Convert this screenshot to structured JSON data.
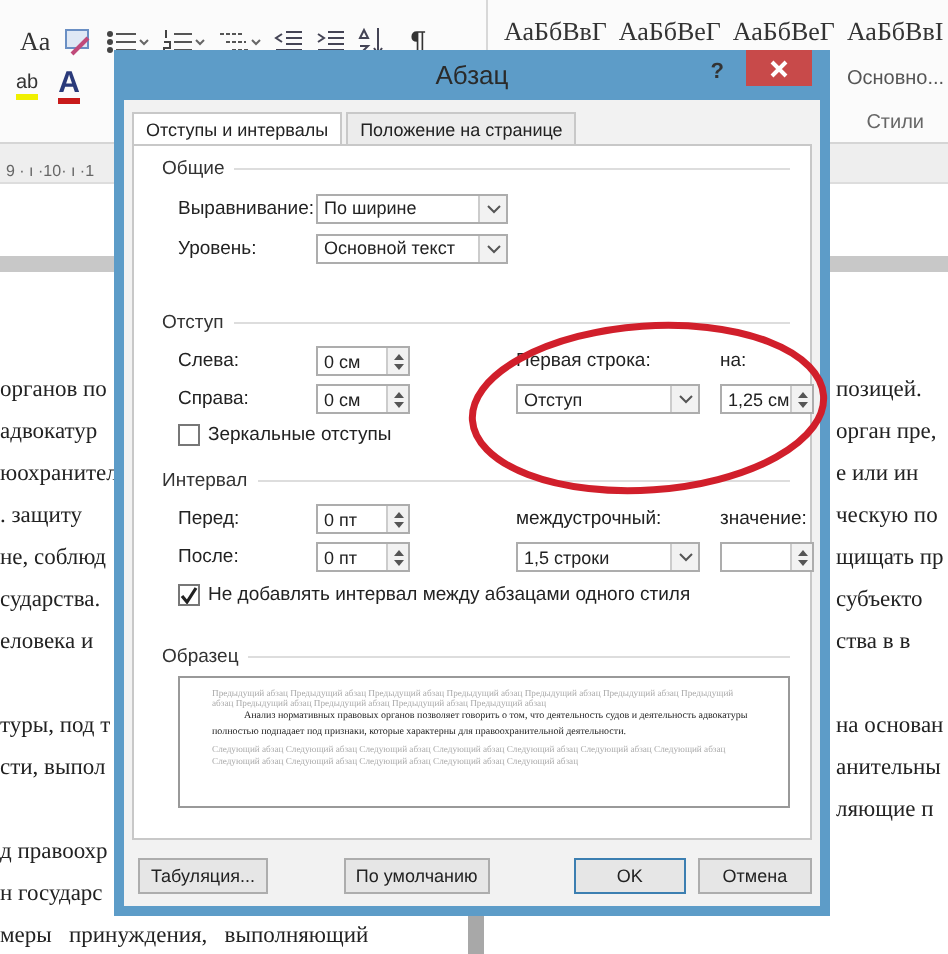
{
  "ribbon": {
    "change_case": "Aa",
    "highlight": "ab",
    "font_color": "A",
    "show_marks": "¶",
    "styles": [
      {
        "sample": "АаБбВвГ"
      },
      {
        "sample": "АаБбВеГ"
      },
      {
        "sample": "АаБбВеГ"
      },
      {
        "sample": "АаБбВвI",
        "name": "Основно..."
      }
    ],
    "styles_group": "Стили",
    "ruler": "9 · ı ·10· ı ·1"
  },
  "document": {
    "rows": [
      {
        "left": "органов по",
        "right": "позицей."
      },
      {
        "left": "адвокатур",
        "right": "орган пре,"
      },
      {
        "left": "юохранител",
        "right": "е или ин"
      },
      {
        "left": ". защиту",
        "right": "ческую по"
      },
      {
        "left": "не, соблюд",
        "right": "щищать пр"
      },
      {
        "left": "сударства.",
        "right": "субъекто"
      },
      {
        "left": "еловека и",
        "right": "ства в в"
      },
      {},
      {
        "left": "туры, под т",
        "right": "на основан"
      },
      {
        "left": "сти, выпол",
        "right": "анительны"
      },
      {
        "right": "ляющие п"
      },
      {
        "left": "д правоохр"
      },
      {
        "left": "н государс"
      },
      {
        "left": "меры   принуждения,   выполняющий"
      }
    ]
  },
  "dialog": {
    "title": "Абзац",
    "help": "?",
    "tabs": [
      {
        "label": "Отступы и интервалы",
        "selected": true
      },
      {
        "label": "Положение на странице",
        "selected": false
      }
    ],
    "general": {
      "title": "Общие",
      "fields": [
        {
          "label": "Выравнивание:",
          "value": "По ширине"
        },
        {
          "label": "Уровень:",
          "value": "Основной текст"
        }
      ]
    },
    "indent": {
      "title": "Отступ",
      "left": {
        "label": "Слева:",
        "value": "0 см"
      },
      "right": {
        "label": "Справа:",
        "value": "0 см"
      },
      "first_line": {
        "label": "Первая строка:",
        "value": "Отступ"
      },
      "by": {
        "label": "на:",
        "value": "1,25 см"
      },
      "mirror": {
        "label": "Зеркальные отступы",
        "checked": false
      }
    },
    "spacing": {
      "title": "Интервал",
      "before": {
        "label": "Перед:",
        "value": "0 пт"
      },
      "after": {
        "label": "После:",
        "value": "0 пт"
      },
      "line": {
        "label": "междустрочный:",
        "value": "1,5 строки"
      },
      "at": {
        "label": "значение:"
      },
      "dont_add": {
        "label": "Не добавлять интервал между абзацами одного стиля",
        "checked": true
      }
    },
    "preview": {
      "title": "Образец",
      "previous": "Предыдущий абзац Предыдущий абзац Предыдущий абзац Предыдущий абзац Предыдущий абзац Предыдущий абзац Предыдущий абзац Предыдущий абзац Предыдущий абзац Предыдущий абзац Предыдущий абзац",
      "current": "Анализ нормативных правовых органов позволяет говорить о том, что деятельность судов и деятельность адвокатуры полностью подпадает под признаки, которые характерны для правоохранительной деятельности.",
      "next": "Следующий абзац Следующий абзац Следующий абзац Следующий абзац Следующий абзац Следующий абзац Следующий абзац Следующий абзац Следующий абзац Следующий абзац Следующий абзац Следующий абзац"
    },
    "buttons": [
      {
        "label": "Табуляция...",
        "default": false
      },
      {
        "label": "По умолчанию",
        "default": false
      },
      {
        "label": "OK",
        "default": true
      },
      {
        "label": "Отмена",
        "default": false
      }
    ]
  }
}
